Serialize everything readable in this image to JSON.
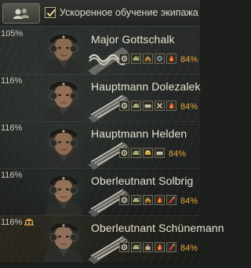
{
  "toolbar": {
    "checkbox_label": "Ускоренное обучение экипажа",
    "checkbox_checked": true,
    "button_icon": "crew-icon"
  },
  "crew": [
    {
      "name": "Major Gottschalk",
      "skill_total": "105%",
      "learning_progress": "84%",
      "rank_insignia": "braided-shoulder-strap-icon",
      "academy": false,
      "skills": [
        "gear-skill-icon",
        "rank-tank-icon",
        "chevron-icon",
        "recon-icon",
        "fire-icon"
      ]
    },
    {
      "name": "Hauptmann Dolezalek",
      "skill_total": "116%",
      "learning_progress": "84%",
      "rank_insignia": "shoulder-strap-icon",
      "academy": false,
      "skills": [
        "gear-skill-icon",
        "rank-tank-icon",
        "vehicle-icon",
        "cross-skill-icon",
        "fire-icon"
      ]
    },
    {
      "name": "Hauptmann Helden",
      "skill_total": "116%",
      "learning_progress": "84%",
      "rank_insignia": "shoulder-strap-icon",
      "academy": false,
      "skills": [
        "gear-skill-icon",
        "rank-tank-icon",
        "repair-icon",
        "vehicle-icon"
      ]
    },
    {
      "name": "Oberleutnant Solbrig",
      "skill_total": "116%",
      "learning_progress": "84%",
      "rank_insignia": "shoulder-strap-icon",
      "academy": false,
      "skills": [
        "gear-skill-icon",
        "rank-tank-icon",
        "chevron-icon",
        "fire-icon",
        "extinguisher-icon"
      ]
    },
    {
      "name": "Oberleutnant Schünemann",
      "skill_total": "116%",
      "learning_progress": "84%",
      "rank_insignia": "shoulder-strap-icon",
      "academy": true,
      "skills": [
        "gear-skill-icon",
        "rank-tank-icon",
        "radio-icon",
        "fire-icon",
        "extinguisher-icon"
      ]
    }
  ],
  "colors": {
    "progress_text": "#e5a83a",
    "name_text": "#e8e4d4",
    "skill_pct_text": "#cfcabb"
  }
}
